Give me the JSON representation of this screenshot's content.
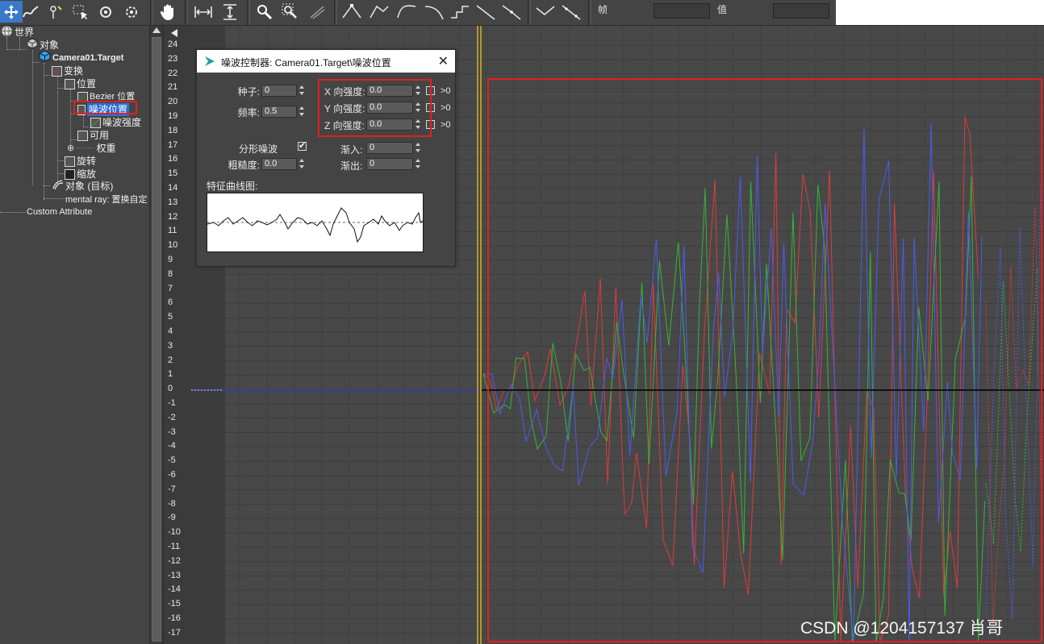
{
  "toolbar": {
    "frame_label": "帧",
    "value_label": "值",
    "tools": [
      "move-keys",
      "draw-curves",
      "insert-key",
      "region-select",
      "pan",
      "zoom",
      "zoom-region",
      "tangents"
    ]
  },
  "tree": {
    "world": "世界",
    "objects": "对象",
    "camera": "Camera01.Target",
    "transform": "变换",
    "position": "位置",
    "bezier_position": "Bezier 位置",
    "noise_position": "噪波位置",
    "noise_strength": "噪波强度",
    "available": "可用",
    "weights": "权重",
    "rotation": "旋转",
    "scale": "缩放",
    "object_target": "对象 (目标)",
    "mental_ray": "mental ray: 置换自定",
    "custom_attribute": "Custom Attribute"
  },
  "ruler": {
    "ticks": [
      "24",
      "23",
      "22",
      "21",
      "20",
      "19",
      "18",
      "17",
      "16",
      "15",
      "14",
      "13",
      "12",
      "11",
      "10",
      "9",
      "8",
      "7",
      "6",
      "5",
      "4",
      "3",
      "2",
      "1",
      "0",
      "-1",
      "-2",
      "-3",
      "-4",
      "-5",
      "-6",
      "-7",
      "-8",
      "-9",
      "-10",
      "-11",
      "-12",
      "-13",
      "-14",
      "-15",
      "-16",
      "-17"
    ]
  },
  "dialog": {
    "title": "噪波控制器: Camera01.Target\\噪波位置",
    "seed_label": "种子:",
    "seed_value": "0",
    "frequency_label": "频率:",
    "frequency_value": "0.5",
    "x_strength_label": "X 向强度:",
    "x_strength_value": "0.0",
    "y_strength_label": "Y 向强度:",
    "y_strength_value": "0.0",
    "z_strength_label": "Z 向强度:",
    "z_strength_value": "0.0",
    "gt0": ">0",
    "fractal_label": "分形噪波",
    "fractal_checked": true,
    "roughness_label": "粗糙度:",
    "roughness_value": "0.0",
    "ramp_in_label": "渐入:",
    "ramp_in_value": "0",
    "ramp_out_label": "渐出:",
    "ramp_out_value": "0",
    "curve_label": "特征曲线图:"
  },
  "watermark": "CSDN @1204157137 肖哥",
  "colors": {
    "highlight_red": "#e02020",
    "selection_blue": "#2d6fd6",
    "curve_x": "#e03a3a",
    "curve_y": "#35b535",
    "curve_z": "#4a5cf0",
    "time_slider": "#d4b21a"
  }
}
